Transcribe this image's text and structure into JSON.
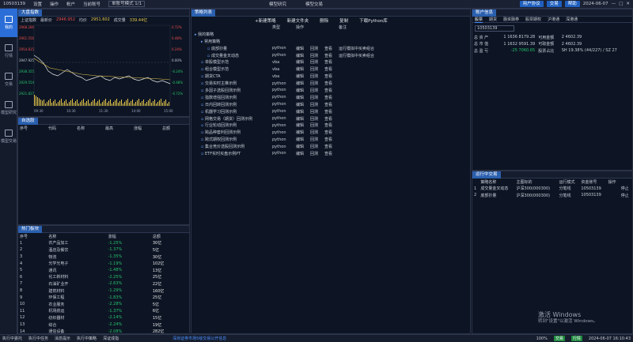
{
  "topbar": {
    "account": "10503139",
    "menu": [
      "设置",
      "操作",
      "帐户"
    ],
    "sel_label": "当前账号",
    "mode": "单账号模式 1/1",
    "center": [
      "模型研究",
      "模型交易"
    ],
    "right": [
      "用户协议",
      "交易",
      "帮助"
    ],
    "date": "2024-06-07"
  },
  "nav": [
    {
      "label": "我的"
    },
    {
      "label": "行情"
    },
    {
      "label": "交易"
    },
    {
      "label": "模型研究"
    },
    {
      "label": "模型交易"
    }
  ],
  "chart": {
    "tab": "大盘指数",
    "index_name": "上证指数",
    "latest_label": "最新价",
    "latest": "2946.952",
    "change_label": "均价",
    "change": "2951.602",
    "vol_label": "成交量",
    "vol": "339.44亿",
    "y_left": [
      "2968.286",
      "2961.556",
      "2954.815",
      "2947.925",
      "2938.355",
      "2929.554",
      "2921.827"
    ],
    "y_right": [
      "0.72%",
      "0.48%",
      "0.24%",
      "0.00%",
      "-0.24%",
      "-0.48%",
      "-0.72%"
    ],
    "x": [
      "09:30",
      "10:30",
      "11:30",
      "14:00",
      "15:00"
    ]
  },
  "stock": {
    "tab": "自选股",
    "cols": [
      "序号",
      "代码",
      "名称",
      "最高",
      "涨幅",
      "总额"
    ]
  },
  "hot": {
    "tab": "热门板块",
    "cols": [
      "序号",
      "名称",
      "涨幅",
      "总额"
    ],
    "rows": [
      [
        "1",
        "农产品加工",
        "-1.25%",
        "30亿"
      ],
      [
        "2",
        "酒店及餐饮",
        "-1.37%",
        "5亿"
      ],
      [
        "3",
        "物流",
        "-1.35%",
        "30亿"
      ],
      [
        "4",
        "光学光电子",
        "-1.19%",
        "102亿"
      ],
      [
        "5",
        "通讯",
        "-1.48%",
        "13亿"
      ],
      [
        "6",
        "化工新材料",
        "-2.25%",
        "25亿"
      ],
      [
        "7",
        "石油矿业开",
        "-2.63%",
        "22亿"
      ],
      [
        "8",
        "建筑材料",
        "-1.29%",
        "160亿"
      ],
      [
        "9",
        "环保工程",
        "-1.83%",
        "25亿"
      ],
      [
        "10",
        "农业服务",
        "-2.28%",
        "5亿"
      ],
      [
        "11",
        "机场航运",
        "-1.37%",
        "6亿"
      ],
      [
        "12",
        "纺织器材",
        "-2.14%",
        "15亿"
      ],
      [
        "13",
        "综合",
        "-2.24%",
        "19亿"
      ],
      [
        "14",
        "通信设备",
        "-2.08%",
        "282亿"
      ]
    ]
  },
  "strategy": {
    "tab": "策略列表",
    "toolbar": [
      "+新建策略",
      "新建文件夹",
      "删除",
      "复制",
      "下载Python库"
    ],
    "cols": [
      "",
      "类型",
      "操作",
      "",
      "",
      "备注"
    ],
    "rows": [
      {
        "name": "我的策略",
        "type": "",
        "ops": [
          "",
          "",
          ""
        ],
        "note": "",
        "indent": 0
      },
      {
        "name": "常用策略",
        "type": "",
        "ops": [
          "",
          "",
          ""
        ],
        "note": "",
        "indent": 1
      },
      {
        "name": "底部抄量",
        "type": "python",
        "ops": [
          "编辑",
          "回测",
          "查看"
        ],
        "note": "运行模拟中买卖组合",
        "indent": 2
      },
      {
        "name": "成交量金叉动态",
        "type": "python",
        "ops": [
          "编辑",
          "回测",
          "查看"
        ],
        "note": "运行模拟中买卖组合",
        "indent": 2
      },
      {
        "name": "单股模型示范",
        "type": "vba",
        "ops": [
          "编辑",
          "回测",
          "查看"
        ],
        "note": "",
        "indent": 1
      },
      {
        "name": "组合模型示范",
        "type": "vba",
        "ops": [
          "编辑",
          "回测",
          "查看"
        ],
        "note": "",
        "indent": 1
      },
      {
        "name": "期货CTA",
        "type": "vba",
        "ops": [
          "编辑",
          "回测",
          "查看"
        ],
        "note": "",
        "indent": 1
      },
      {
        "name": "交易实时主推示例",
        "type": "python",
        "ops": [
          "编辑",
          "回测",
          "查看"
        ],
        "note": "",
        "indent": 1
      },
      {
        "name": "多因子选股回测示例",
        "type": "python",
        "ops": [
          "编辑",
          "回测",
          "查看"
        ],
        "note": "",
        "indent": 1
      },
      {
        "name": "指数增强回测示例",
        "type": "python",
        "ops": [
          "编辑",
          "回测",
          "查看"
        ],
        "note": "",
        "indent": 1
      },
      {
        "name": "日内回转回测示例",
        "type": "python",
        "ops": [
          "编辑",
          "回测",
          "查看"
        ],
        "note": "",
        "indent": 1
      },
      {
        "name": "机器学习回测示例",
        "type": "python",
        "ops": [
          "编辑",
          "回测",
          "查看"
        ],
        "note": "",
        "indent": 1
      },
      {
        "name": "网格交易（期货）回测示例",
        "type": "python",
        "ops": [
          "编辑",
          "回测",
          "查看"
        ],
        "note": "",
        "indent": 1
      },
      {
        "name": "行业轮动回测示例",
        "type": "python",
        "ops": [
          "编辑",
          "回测",
          "查看"
        ],
        "note": "",
        "indent": 1
      },
      {
        "name": "跨品种套利回测示例",
        "type": "python",
        "ops": [
          "编辑",
          "回测",
          "查看"
        ],
        "note": "",
        "indent": 1
      },
      {
        "name": "跨式期权回测示例",
        "type": "python",
        "ops": [
          "编辑",
          "回测",
          "查看"
        ],
        "note": "",
        "indent": 1
      },
      {
        "name": "集合竞价选股回测示例",
        "type": "python",
        "ops": [
          "编辑",
          "回测",
          "查看"
        ],
        "note": "",
        "indent": 1
      },
      {
        "name": "ETF实时买盘示例PT",
        "type": "python",
        "ops": [
          "编辑",
          "回测",
          "查看"
        ],
        "note": "",
        "indent": 1
      }
    ]
  },
  "account": {
    "tab": "账户信息",
    "tabs": [
      "股票",
      "期货",
      "融资融券",
      "股票期权",
      "沪港通",
      "深港通"
    ],
    "acct": "10503139",
    "rows": [
      [
        "总 资 产",
        "1 1636 8179.28",
        "可用金额",
        "2 4602.39"
      ],
      [
        "总 市 值",
        "1 1632 9591.39",
        "可取金额",
        "2 4602.39"
      ],
      [
        "总 盈 亏",
        "-25 7060.65",
        "股票占比",
        "SH 19.38% (44/227) / SZ 27"
      ]
    ]
  },
  "running": {
    "tab": "运行中交易",
    "cols": [
      "",
      "策略名称",
      "主图标的",
      "运行模式",
      "资金账号",
      "操作",
      ""
    ],
    "rows": [
      [
        "1",
        "成交量金叉动态",
        "沪深300(000300)",
        "分笔线",
        "10503139",
        "",
        "停止"
      ],
      [
        "2",
        "底部抄量",
        "沪深300(000300)",
        "分笔线",
        "10503139",
        "",
        "停止"
      ]
    ]
  },
  "status": {
    "items": [
      "执行中委托",
      "执行中任务",
      "消息提示",
      "执行中策略",
      "深证成指"
    ],
    "news": "深圳证券市场5级交易公开信息",
    "zoom": "100%",
    "btns": [
      "交易",
      "行情"
    ],
    "time": "2024-06-07 16:10:43"
  },
  "watermark": {
    "l1": "激活 Windows",
    "l2": "转到\"设置\"以激活 Windows。"
  }
}
